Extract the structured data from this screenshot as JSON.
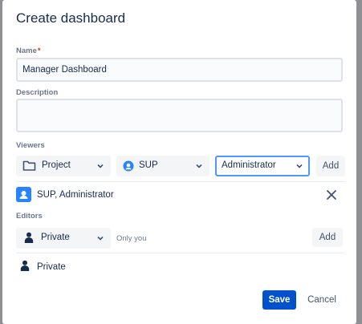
{
  "dialog": {
    "title": "Create dashboard",
    "name": {
      "label": "Name",
      "required_mark": "*",
      "value": "Manager Dashboard"
    },
    "description": {
      "label": "Description",
      "value": ""
    },
    "viewers": {
      "label": "Viewers",
      "type_select": "Project",
      "project_select": "SUP",
      "role_select": "Administrator",
      "add_label": "Add",
      "entry": "SUP, Administrator"
    },
    "editors": {
      "label": "Editors",
      "select": "Private",
      "helper": "Only you",
      "add_label": "Add",
      "entry": "Private"
    },
    "footer": {
      "save_label": "Save",
      "cancel_label": "Cancel"
    }
  },
  "colors": {
    "primary": "#0052cc",
    "focus": "#4c9aff",
    "required": "#de350b",
    "background": "#8f9094"
  }
}
